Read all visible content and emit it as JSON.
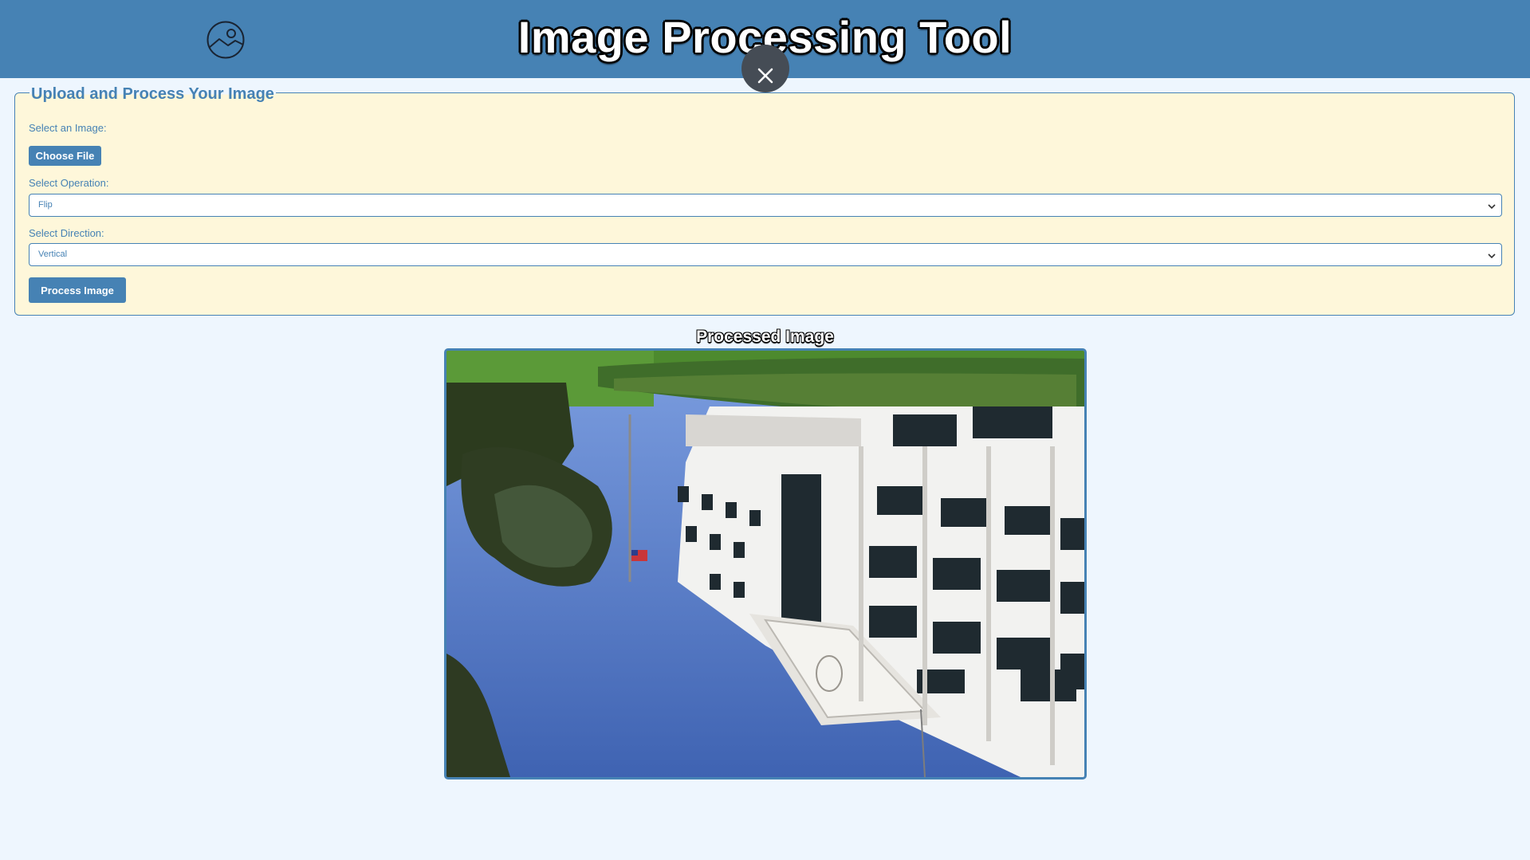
{
  "header": {
    "title": "Image Processing Tool",
    "logo_icon": "image-icon",
    "close_icon": "close-icon",
    "background_color": "#4682b4"
  },
  "form": {
    "legend": "Upload and Process Your Image",
    "image_label": "Select an Image:",
    "choose_file_label": "Choose File",
    "operation_label": "Select Operation:",
    "operation_value": "Flip",
    "direction_label": "Select Direction:",
    "direction_value": "Vertical",
    "process_label": "Process Image",
    "background_color": "#fef7da",
    "accent_color": "#4682b4"
  },
  "result": {
    "title": "Processed Image",
    "image_description_icon": "processed-photo"
  }
}
